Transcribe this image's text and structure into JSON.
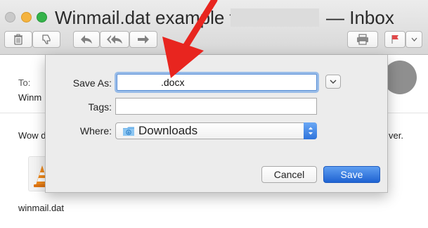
{
  "window": {
    "title_prefix": "Winmail.dat example for",
    "title_suffix": "— Inbox"
  },
  "icons": {
    "toolbar": [
      "trash-icon",
      "junk-thumbs-down-icon",
      "reply-icon",
      "reply-all-icon",
      "forward-icon",
      "print-icon",
      "flag-icon",
      "chevron-down-icon"
    ],
    "sheet": [
      "chevron-down-icon",
      "downloads-folder-icon",
      "up-down-arrows-icon"
    ],
    "annotation": "red-arrow-icon"
  },
  "mail": {
    "to_label": "To:",
    "from_fragment": "Winm",
    "body_start": "Wow d",
    "body_end": "ver.",
    "attachment_name": "winmail.dat"
  },
  "save_dialog": {
    "save_as_label": "Save As:",
    "save_as_value": ".docx",
    "tags_label": "Tags:",
    "tags_value": "",
    "where_label": "Where:",
    "where_value": "Downloads",
    "cancel_label": "Cancel",
    "save_label": "Save"
  },
  "colors": {
    "accent_blue": "#2f74db",
    "annotation_red": "#e8251f",
    "flag_red": "#e0494a"
  }
}
